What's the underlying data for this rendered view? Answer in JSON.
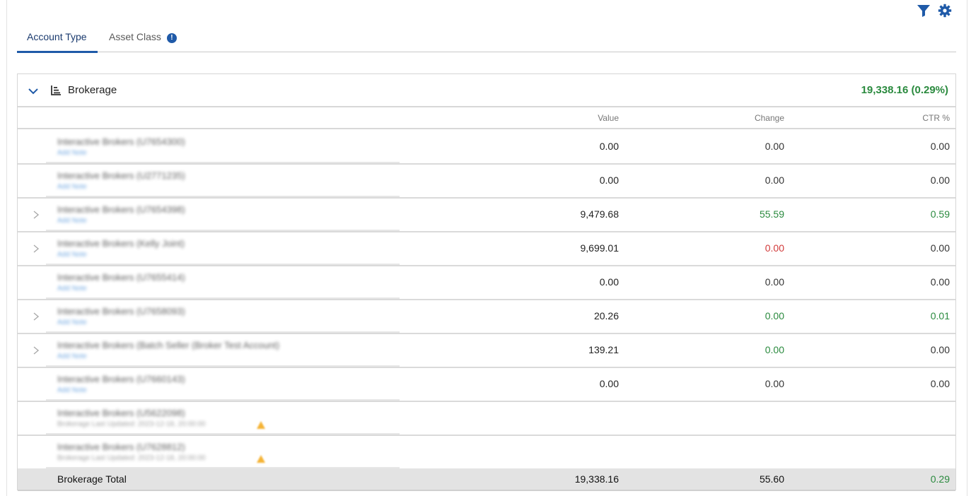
{
  "toolbar": {
    "filter_icon": "filter-icon",
    "settings_icon": "gear-icon"
  },
  "tabs": [
    {
      "label": "Account Type",
      "active": true
    },
    {
      "label": "Asset Class",
      "badge": "!"
    }
  ],
  "group": {
    "title": "Brokerage",
    "total_summary": "19,338.16 (0.29%)",
    "columns": {
      "value": "Value",
      "change": "Change",
      "ctr": "CTR %"
    },
    "rows": [
      {
        "name": "Interactive Brokers (U7654300)",
        "sub": "Add Note",
        "value": "0.00",
        "change": "0.00",
        "ctr": "0.00",
        "expandable": false
      },
      {
        "name": "Interactive Brokers (U2771235)",
        "sub": "Add Note",
        "value": "0.00",
        "change": "0.00",
        "ctr": "0.00",
        "expandable": false
      },
      {
        "name": "Interactive Brokers (U7654398)",
        "sub": "Add Note",
        "value": "9,479.68",
        "change": "55.59",
        "ctr": "0.59",
        "expandable": true,
        "change_class": "pos",
        "ctr_class": "pos"
      },
      {
        "name": "Interactive Brokers (Kelly Joint)",
        "sub": "Add Note",
        "value": "9,699.01",
        "change": "0.00",
        "ctr": "0.00",
        "expandable": true,
        "change_class": "neg"
      },
      {
        "name": "Interactive Brokers (U7655414)",
        "sub": "Add Note",
        "value": "0.00",
        "change": "0.00",
        "ctr": "0.00",
        "expandable": false
      },
      {
        "name": "Interactive Brokers (U7658093)",
        "sub": "Add Note",
        "value": "20.26",
        "change": "0.00",
        "ctr": "0.01",
        "expandable": true,
        "change_class": "pos",
        "ctr_class": "pos"
      },
      {
        "name": "Interactive Brokers (Batch Seller (Broker Test Account)",
        "sub": "Add Note",
        "value": "139.21",
        "change": "0.00",
        "ctr": "0.00",
        "expandable": true,
        "change_class": "pos"
      },
      {
        "name": "Interactive Brokers (U7660143)",
        "sub": "Add Note",
        "value": "0.00",
        "change": "0.00",
        "ctr": "0.00",
        "expandable": false
      },
      {
        "name": "Interactive Brokers (U5622098)",
        "sub": "Brokerage Last Updated: 2023-12-18, 20:00:00",
        "value": "",
        "change": "",
        "ctr": "",
        "expandable": false,
        "warning": true
      },
      {
        "name": "Interactive Brokers (U7628812)",
        "sub": "Brokerage Last Updated: 2023-12-18, 20:00:00",
        "value": "",
        "change": "",
        "ctr": "",
        "expandable": false,
        "warning": true
      }
    ],
    "total": {
      "label": "Brokerage Total",
      "value": "19,338.16",
      "change": "55.60",
      "ctr": "0.29"
    }
  },
  "colors": {
    "accent": "#1f5aa8",
    "positive": "#2a8a3e",
    "negative": "#d23a3a"
  }
}
